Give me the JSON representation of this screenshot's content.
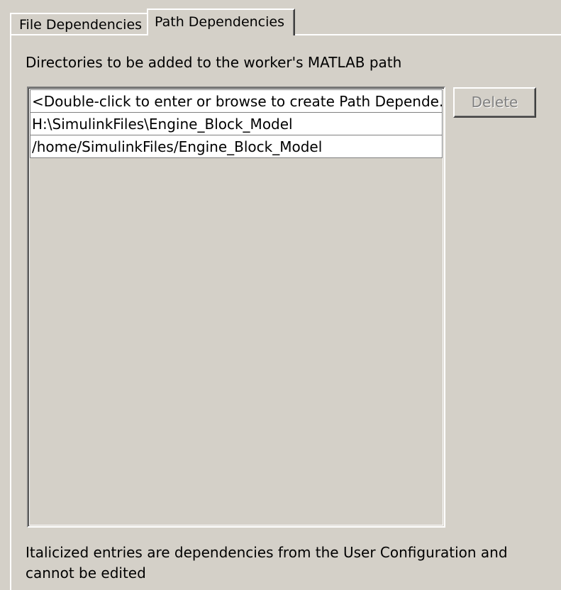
{
  "tabs": [
    {
      "label": "File Dependencies",
      "active": false
    },
    {
      "label": "Path Dependencies",
      "active": true
    }
  ],
  "panel": {
    "description": "Directories to be added to the worker's MATLAB path",
    "list_items": [
      "<Double-click to enter or browse to create Path Depende...",
      "H:\\SimulinkFiles\\Engine_Block_Model",
      "/home/SimulinkFiles/Engine_Block_Model"
    ],
    "delete_label": "Delete",
    "delete_enabled": false,
    "note": "Italicized entries are dependencies from the User Configuration and cannot be edited"
  },
  "colors": {
    "background": "#d4d0c8",
    "disabled_text": "#808080"
  }
}
